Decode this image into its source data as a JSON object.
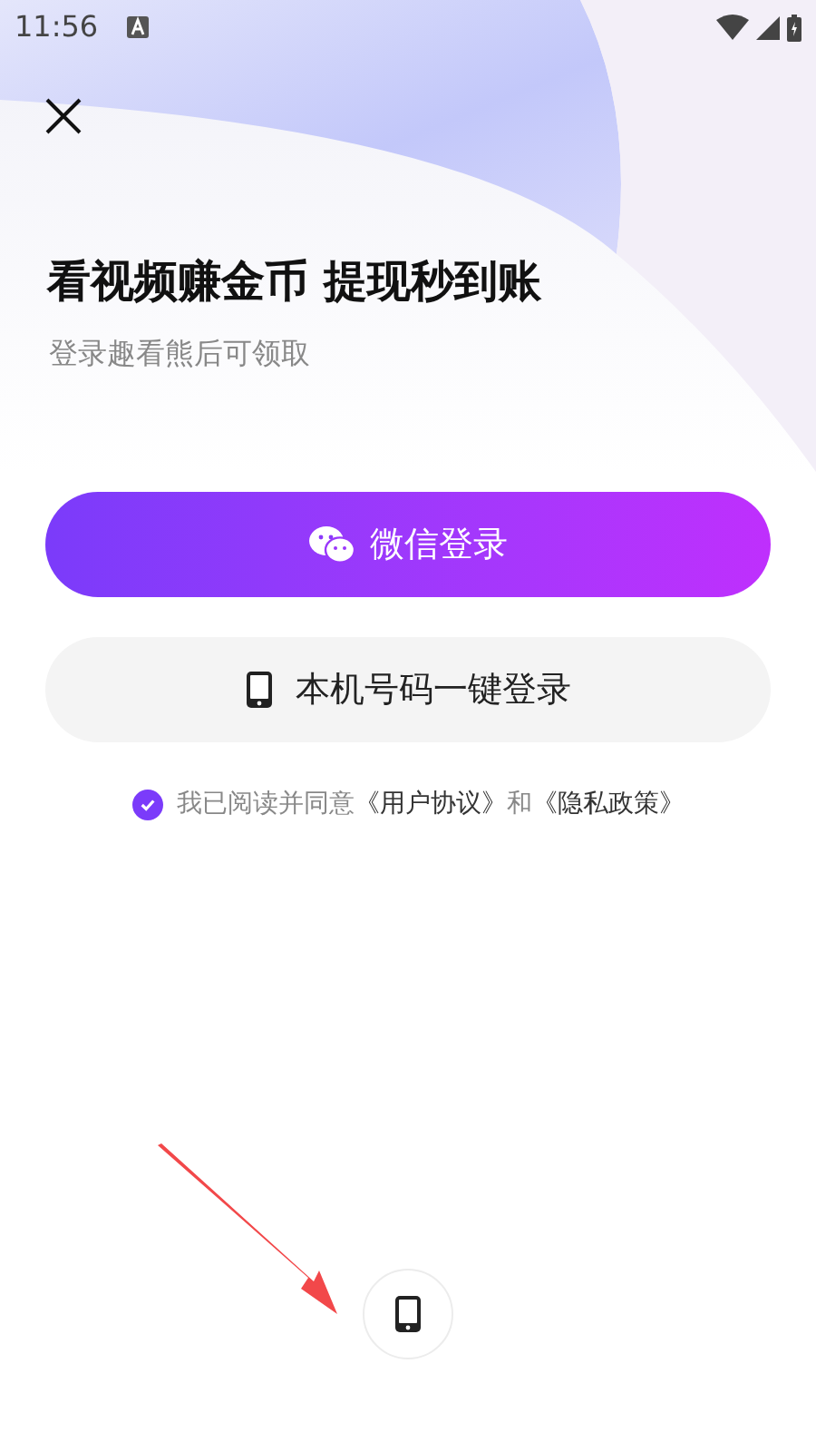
{
  "status_bar": {
    "time": "11:56"
  },
  "title": "看视频赚金币 提现秒到账",
  "subtitle": "登录趣看熊后可领取",
  "buttons": [
    {
      "kind": "wechat",
      "label": "微信登录"
    },
    {
      "kind": "phone",
      "label": "本机号码一键登录"
    }
  ],
  "agreement": {
    "checked": true,
    "parts": [
      {
        "kind": "text",
        "text": "我已阅读并同意"
      },
      {
        "kind": "link",
        "text": "《用户协议》"
      },
      {
        "kind": "text",
        "text": "和"
      },
      {
        "kind": "link",
        "text": "《隐私政策》"
      }
    ]
  },
  "other_login": [
    {
      "kind": "phone"
    }
  ],
  "annotation": {
    "kind": "arrow"
  }
}
